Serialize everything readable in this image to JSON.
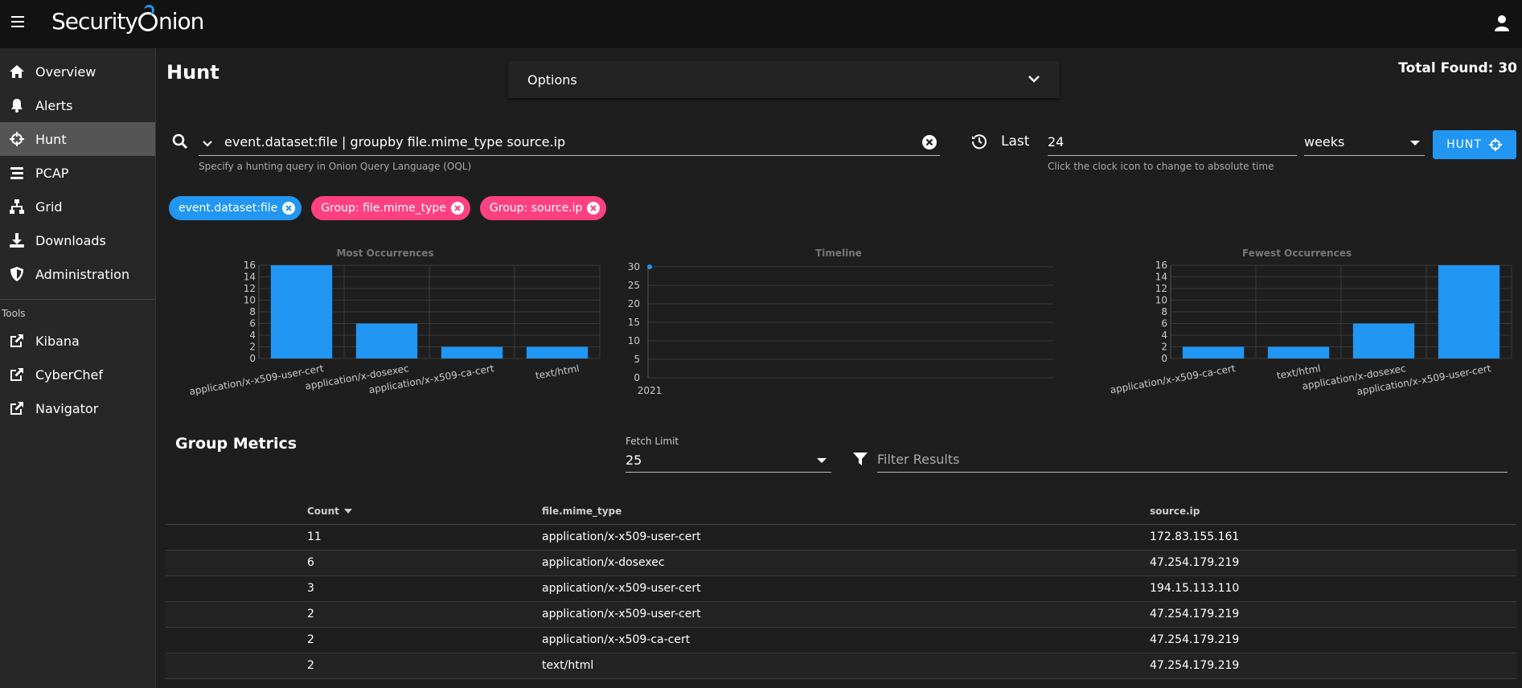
{
  "app": {
    "brand": "Security Onion"
  },
  "sidebar": {
    "items": [
      {
        "label": "Overview",
        "icon": "home-icon"
      },
      {
        "label": "Alerts",
        "icon": "bell-icon"
      },
      {
        "label": "Hunt",
        "icon": "crosshairs-icon"
      },
      {
        "label": "PCAP",
        "icon": "stream-icon"
      },
      {
        "label": "Grid",
        "icon": "network-icon"
      },
      {
        "label": "Downloads",
        "icon": "download-icon"
      },
      {
        "label": "Administration",
        "icon": "shield-icon"
      }
    ],
    "tools_label": "Tools",
    "tools": [
      {
        "label": "Kibana",
        "icon": "external-link-icon"
      },
      {
        "label": "CyberChef",
        "icon": "external-link-icon"
      },
      {
        "label": "Navigator",
        "icon": "external-link-icon"
      }
    ]
  },
  "main": {
    "title": "Hunt",
    "options_label": "Options",
    "total_found": "Total Found: 30",
    "query": {
      "value": "event.dataset:file | groupby file.mime_type source.ip",
      "hint": "Specify a hunting query in Onion Query Language (OQL)"
    },
    "time": {
      "last_label": "Last",
      "value": "24",
      "unit": "weeks",
      "hint": "Click the clock icon to change to absolute time"
    },
    "hunt_button": "HUNT",
    "chips": [
      {
        "label": "event.dataset:file",
        "color": "#2196f3"
      },
      {
        "label": "Group: file.mime_type",
        "color": "#ff4081"
      },
      {
        "label": "Group: source.ip",
        "color": "#ff4081"
      }
    ],
    "group_metrics": {
      "title": "Group Metrics",
      "fetch_label": "Fetch Limit",
      "fetch_value": "25",
      "filter_placeholder": "Filter Results",
      "columns": [
        "Count",
        "file.mime_type",
        "source.ip"
      ],
      "rows": [
        [
          "11",
          "application/x-x509-user-cert",
          "172.83.155.161"
        ],
        [
          "6",
          "application/x-dosexec",
          "47.254.179.219"
        ],
        [
          "3",
          "application/x-x509-user-cert",
          "194.15.113.110"
        ],
        [
          "2",
          "application/x-x509-user-cert",
          "47.254.179.219"
        ],
        [
          "2",
          "application/x-x509-ca-cert",
          "47.254.179.219"
        ],
        [
          "2",
          "text/html",
          "47.254.179.219"
        ]
      ]
    }
  },
  "colors": {
    "accent": "#2196f3",
    "chip_pink": "#ff4081"
  },
  "chart_data": [
    {
      "type": "bar",
      "title": "Most Occurrences",
      "categories": [
        "application/x-x509-user-cert",
        "application/x-dosexec",
        "application/x-x509-ca-cert",
        "text/html"
      ],
      "values": [
        16,
        6,
        2,
        2
      ],
      "ylim": [
        0,
        16
      ],
      "yticks": [
        0,
        2,
        4,
        6,
        8,
        10,
        12,
        14,
        16
      ]
    },
    {
      "type": "line",
      "title": "Timeline",
      "x": [
        "2021"
      ],
      "values": [
        30
      ],
      "ylim": [
        0,
        30
      ],
      "yticks": [
        0,
        5,
        10,
        15,
        20,
        25,
        30
      ]
    },
    {
      "type": "bar",
      "title": "Fewest Occurrences",
      "categories": [
        "application/x-x509-ca-cert",
        "text/html",
        "application/x-dosexec",
        "application/x-x509-user-cert"
      ],
      "values": [
        2,
        2,
        6,
        16
      ],
      "ylim": [
        0,
        16
      ],
      "yticks": [
        0,
        2,
        4,
        6,
        8,
        10,
        12,
        14,
        16
      ]
    }
  ]
}
